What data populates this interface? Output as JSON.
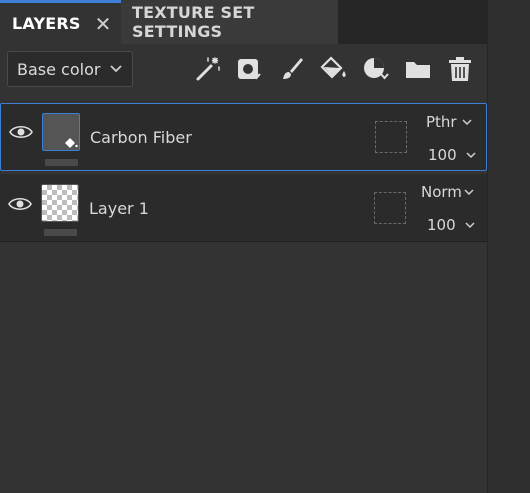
{
  "tabs": {
    "layers": "LAYERS",
    "texture_set_settings": "TEXTURE SET SETTINGS"
  },
  "channel_select": {
    "value": "Base color"
  },
  "toolbar": {
    "tools": [
      "magic-wand-icon",
      "add-mask-icon",
      "paint-brush-icon",
      "fill-bucket-icon",
      "smart-material-icon",
      "folder-icon",
      "trash-icon"
    ]
  },
  "layers": [
    {
      "name": "Carbon Fiber",
      "blend_mode": "Pthr",
      "opacity": "100",
      "selected": true
    },
    {
      "name": "Layer 1",
      "blend_mode": "Norm",
      "opacity": "100",
      "selected": false
    }
  ],
  "colors": {
    "accent": "#3d7fd6",
    "panel_bg": "#333333",
    "row_bg": "#2b2b2b"
  }
}
